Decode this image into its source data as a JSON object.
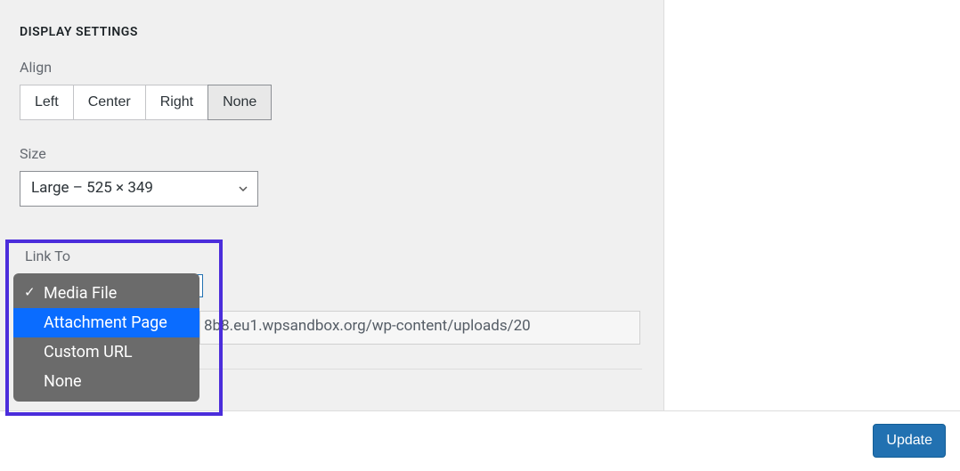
{
  "section_title": "DISPLAY SETTINGS",
  "align": {
    "label": "Align",
    "options": [
      "Left",
      "Center",
      "Right",
      "None"
    ],
    "selected": "None"
  },
  "size": {
    "label": "Size",
    "selected": "Large – 525 × 349"
  },
  "link_to": {
    "label": "Link To",
    "options": [
      {
        "label": "Media File",
        "checked": true,
        "highlighted": false
      },
      {
        "label": "Attachment Page",
        "checked": false,
        "highlighted": true
      },
      {
        "label": "Custom URL",
        "checked": false,
        "highlighted": false
      },
      {
        "label": "None",
        "checked": false,
        "highlighted": false
      }
    ]
  },
  "url_value": "8b8.eu1.wpsandbox.org/wp-content/uploads/20",
  "update_button": "Update",
  "colors": {
    "highlight_border": "#4b2ddb",
    "dropdown_bg": "#6b6b6b",
    "dropdown_highlight": "#0a6cff",
    "primary_button": "#2271b1"
  }
}
